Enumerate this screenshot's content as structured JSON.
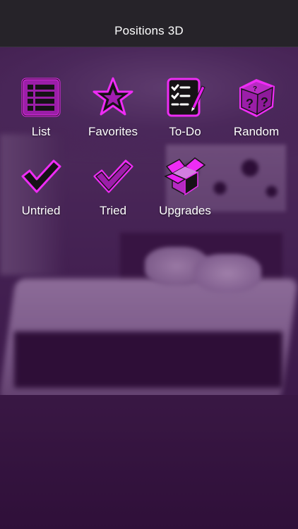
{
  "navbar": {
    "title": "Positions 3D"
  },
  "colors": {
    "accent": "#e81ff0",
    "icon_fill": "#9b1ea8",
    "icon_dark": "#161216",
    "navbar_bg": "#262329"
  },
  "menu": {
    "items": [
      {
        "label": "List",
        "icon": "list-icon"
      },
      {
        "label": "Favorites",
        "icon": "star-icon"
      },
      {
        "label": "To-Do",
        "icon": "todo-checklist-icon"
      },
      {
        "label": "Random",
        "icon": "question-dice-icon"
      },
      {
        "label": "Untried",
        "icon": "checkmark-dark-icon"
      },
      {
        "label": "Tried",
        "icon": "checkmark-purple-icon"
      },
      {
        "label": "Upgrades",
        "icon": "open-box-icon"
      }
    ]
  }
}
